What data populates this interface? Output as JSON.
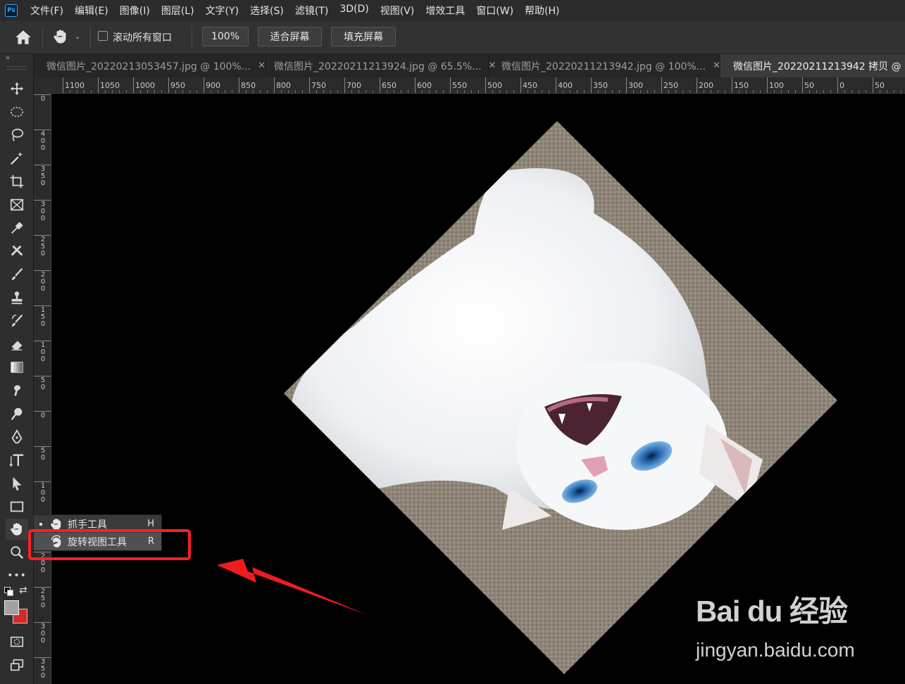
{
  "app": {
    "logo_text": "Ps"
  },
  "menu": [
    "文件(F)",
    "编辑(E)",
    "图像(I)",
    "图层(L)",
    "文字(Y)",
    "选择(S)",
    "滤镜(T)",
    "3D(D)",
    "视图(V)",
    "增效工具",
    "窗口(W)",
    "帮助(H)"
  ],
  "options": {
    "scroll_all_label": "滚动所有窗口",
    "scroll_all_checked": false,
    "zoom_value": "100%",
    "fit_screen_label": "适合屏幕",
    "fill_screen_label": "填充屏幕"
  },
  "tabs": [
    {
      "label": "微信图片_20220213053457.jpg @ 100%...",
      "active": false
    },
    {
      "label": "微信图片_20220211213924.jpg @ 65.5%...",
      "active": false
    },
    {
      "label": "微信图片_20220211213942.jpg @ 100%...",
      "active": false
    },
    {
      "label": "微信图片_20220211213942 拷贝 @ 10",
      "active": true
    }
  ],
  "ruler_top_labels": [
    "1100",
    "1050",
    "1000",
    "950",
    "900",
    "850",
    "800",
    "750",
    "700",
    "650",
    "600",
    "550",
    "500",
    "450",
    "400",
    "350",
    "300",
    "250",
    "200",
    "150",
    "100",
    "50",
    "0",
    "50"
  ],
  "ruler_left_labels": [
    "0",
    "400",
    "350",
    "300",
    "250",
    "200",
    "150",
    "100",
    "50",
    "0",
    "50",
    "100",
    "150",
    "200",
    "250",
    "300",
    "350"
  ],
  "toolbar": {
    "collapse_glyph": "»",
    "tools": [
      "move-tool",
      "marquee-tool",
      "lasso-tool",
      "magic-wand-tool",
      "crop-tool",
      "frame-tool",
      "eyedropper-tool",
      "healing-tool",
      "brush-tool",
      "stamp-tool",
      "history-brush-tool",
      "eraser-tool",
      "gradient-tool",
      "smudge-tool",
      "dodge-tool",
      "pen-tool",
      "type-tool",
      "path-selection-tool",
      "rectangle-tool",
      "hand-tool",
      "zoom-tool",
      "more-tools"
    ],
    "more_glyph": "•••",
    "foreground_color": "#a8a0a0",
    "background_color": "#d42a2a"
  },
  "flyout": {
    "items": [
      {
        "label": "抓手工具",
        "key": "H",
        "selected": true
      },
      {
        "label": "旋转视图工具",
        "key": "R",
        "selected": false
      }
    ]
  },
  "annotation": {
    "box_color": "#ff2020",
    "arrow_color": "#f01c1c"
  },
  "watermark": {
    "logo": "Bai du 经验",
    "url": "jingyan.baidu.com"
  }
}
